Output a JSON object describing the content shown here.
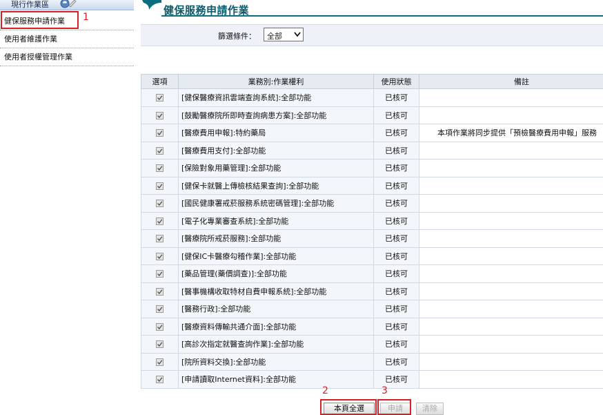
{
  "sidebar": {
    "title": "現行作業區",
    "items": [
      {
        "label": "健保服務申請作業"
      },
      {
        "label": "使用者維護作業"
      },
      {
        "label": "使用者授權管理作業"
      }
    ]
  },
  "page": {
    "title": "健保服務申請作業"
  },
  "filter": {
    "label": "篩選條件：",
    "selected": "全部"
  },
  "table": {
    "headers": [
      "選項",
      "業務別:作業權利",
      "使用狀態",
      "備註"
    ],
    "rows": [
      {
        "checked": true,
        "name": "[健保醫療資訊雲端查詢系統]:全部功能",
        "status": "已核可",
        "note": ""
      },
      {
        "checked": true,
        "name": "[鼓勵醫療院所即時查詢病患方案]:全部功能",
        "status": "已核可",
        "note": ""
      },
      {
        "checked": true,
        "name": "[醫療費用申報]:特約藥局",
        "status": "已核可",
        "note": "本項作業將同步提供「預檢醫療費用申報」服務"
      },
      {
        "checked": true,
        "name": "[醫療費用支付]:全部功能",
        "status": "已核可",
        "note": ""
      },
      {
        "checked": true,
        "name": "[保險對象用藥管理]:全部功能",
        "status": "已核可",
        "note": ""
      },
      {
        "checked": true,
        "name": "[健保卡就醫上傳檢核結果查詢]:全部功能",
        "status": "已核可",
        "note": ""
      },
      {
        "checked": true,
        "name": "[國民健康署戒菸服務系統密碼管理]:全部功能",
        "status": "已核可",
        "note": ""
      },
      {
        "checked": true,
        "name": "[電子化專業審查系統]:全部功能",
        "status": "已核可",
        "note": ""
      },
      {
        "checked": true,
        "name": "[醫療院所戒菸服務]:全部功能",
        "status": "已核可",
        "note": ""
      },
      {
        "checked": true,
        "name": "[健保IC卡醫療勾稽作業]:全部功能",
        "status": "已核可",
        "note": ""
      },
      {
        "checked": true,
        "name": "[藥品管理(藥價調查)]:全部功能",
        "status": "已核可",
        "note": ""
      },
      {
        "checked": true,
        "name": "[醫事機構收取特材自費申報系統]:全部功能",
        "status": "已核可",
        "note": ""
      },
      {
        "checked": true,
        "name": "[醫務行政]:全部功能",
        "status": "已核可",
        "note": ""
      },
      {
        "checked": true,
        "name": "[醫療資料傳輸共通介面]:全部功能",
        "status": "已核可",
        "note": ""
      },
      {
        "checked": true,
        "name": "[高診次指定就醫查詢作業]:全部功能",
        "status": "已核可",
        "note": ""
      },
      {
        "checked": true,
        "name": "[院所資料交換]:全部功能",
        "status": "已核可",
        "note": ""
      },
      {
        "checked": true,
        "name": "[申請讀取Internet資料]:全部功能",
        "status": "已核可",
        "note": ""
      }
    ]
  },
  "buttons": {
    "select_all": "本頁全選",
    "apply": "申請",
    "clear": "清除"
  },
  "annotations": [
    "1",
    "2",
    "3"
  ],
  "colors": {
    "title_teal": "#0a5c6c",
    "annotation_red": "#d61f26",
    "header_bg": "#e6ebf2"
  },
  "icons": {
    "sidebar_header": "phone-handset-icon",
    "title": "speech-bubble-icon",
    "checkbox": "checkmark-icon",
    "dropdown": "chevron-down-icon"
  }
}
